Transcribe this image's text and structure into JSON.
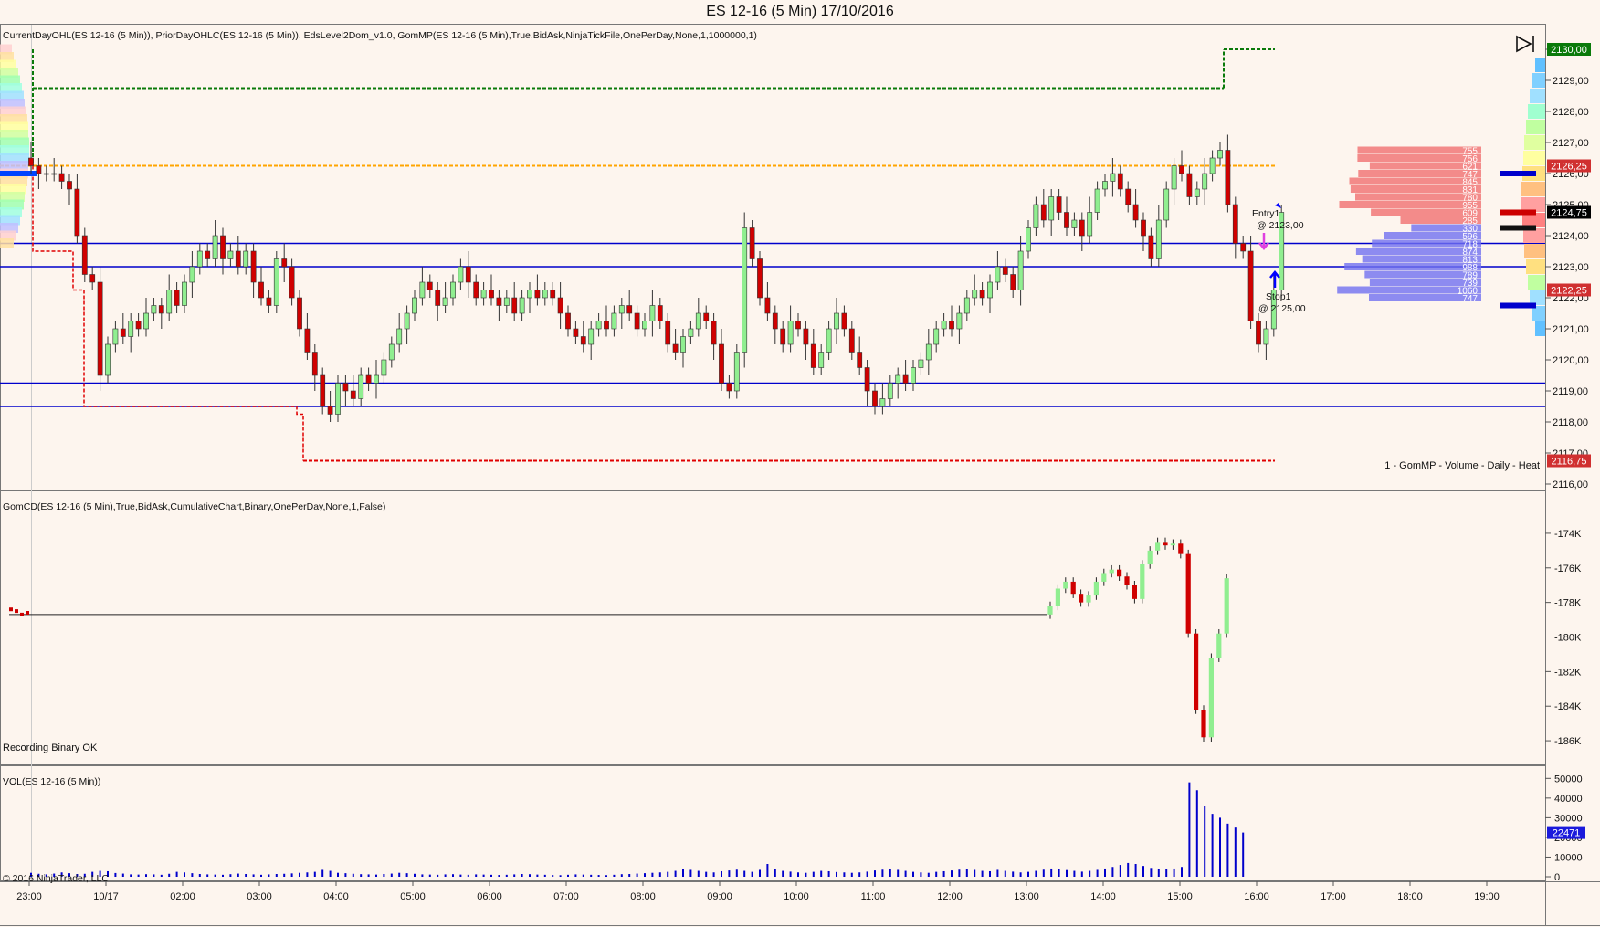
{
  "window": {
    "title": "ES 12-16 (5 Min)  17/10/2016"
  },
  "colors": {
    "background": "#fdf5ee",
    "up_candle": "#90ee90",
    "down_candle": "#d00000",
    "hline_blue": "#0000cc",
    "prior_high_green": "#0a7a0a",
    "orange_level": "#ffa500",
    "red_level": "#e00000",
    "volume_bar": "#0000cc"
  },
  "panels": {
    "price": {
      "indicator_label": "CurrentDayOHL(ES 12-16 (5 Min)), PriorDayOHLC(ES 12-16 (5 Min)), EdsLevel2Dom_v1.0, GomMP(ES 12-16 (5 Min),True,BidAsk,NinjaTickFile,OnePerDay,None,1,1000000,1)",
      "footer_label": "1 - GomMP  - Volume - Daily - Heat",
      "axis_ticks": [
        "2130,00",
        "2129,00",
        "2128,00",
        "2127,00",
        "2126,00",
        "2125,00",
        "2124,00",
        "2123,00",
        "2122,00",
        "2121,00",
        "2120,00",
        "2119,00",
        "2118,00",
        "2117,00",
        "2116,00"
      ],
      "badges": [
        {
          "text": "2130,00",
          "color": "#0a7a0a"
        },
        {
          "text": "2126,25",
          "color": "#d03030"
        },
        {
          "text": "2124,75",
          "color": "#000000"
        },
        {
          "text": "2122,25",
          "color": "#d03030"
        },
        {
          "text": "2116,75",
          "color": "#d03030"
        }
      ],
      "entry_label": "Entry1",
      "entry_price": "@ 2123,00",
      "stop_label": "Stop1",
      "stop_price": "@ 2125,00",
      "dom_values_ask": [
        "755",
        "756",
        "621",
        "747",
        "845",
        "831",
        "780",
        "955",
        "609",
        "285"
      ],
      "dom_values_bid": [
        "330",
        "596",
        "718",
        "874",
        "813",
        "988",
        "789",
        "739",
        "1060",
        "747"
      ],
      "replay_icon": "skip-to-end-icon"
    },
    "cumulative_delta": {
      "indicator_label": "GomCD(ES 12-16 (5 Min),True,BidAsk,CumulativeChart,Binary,OnePerDay,None,1,False)",
      "status_label": "Recording Binary OK",
      "axis_ticks": [
        "-174K",
        "-176K",
        "-178K",
        "-180K",
        "-182K",
        "-184K",
        "-186K"
      ]
    },
    "volume": {
      "indicator_label": "VOL(ES 12-16 (5 Min))",
      "copyright": "© 2016 NinjaTrader, LLC",
      "axis_ticks": [
        "50000",
        "40000",
        "30000",
        "20000",
        "10000",
        "0"
      ],
      "badge": "22471"
    }
  },
  "time_axis": [
    "23:00",
    "10/17",
    "02:00",
    "03:00",
    "04:00",
    "05:00",
    "06:00",
    "07:00",
    "08:00",
    "09:00",
    "10:00",
    "11:00",
    "12:00",
    "13:00",
    "14:00",
    "15:00",
    "16:00",
    "17:00",
    "18:00",
    "19:00"
  ],
  "chart_data": [
    {
      "type": "candlestick",
      "title": "ES 12-16 (5 Min)  17/10/2016",
      "ylim": [
        2116,
        2130.5
      ],
      "interval": "5 Min",
      "x_range": [
        "22:45",
        "19:45"
      ],
      "levels": [
        {
          "name": "prior high",
          "value": 2128.75
        },
        {
          "name": "orange level",
          "value": 2126.25
        },
        {
          "name": "blue line 1",
          "value": 2123.75
        },
        {
          "name": "blue line 2",
          "value": 2123.0
        },
        {
          "name": "prior close",
          "value": 2122.25
        },
        {
          "name": "blue line 3",
          "value": 2119.25
        },
        {
          "name": "blue line 4",
          "value": 2118.5
        },
        {
          "name": "prior low",
          "value": 2116.75
        },
        {
          "name": "green dashed high",
          "value": 2130.0
        }
      ],
      "closes": [
        2126.25,
        2126.0,
        2126.0,
        2126.0,
        2125.75,
        2125.5,
        2124.0,
        2122.75,
        2122.5,
        2119.5,
        2120.5,
        2121.0,
        2120.75,
        2121.25,
        2121.0,
        2121.5,
        2121.75,
        2121.5,
        2122.25,
        2121.75,
        2122.5,
        2123.0,
        2123.5,
        2123.25,
        2124.0,
        2123.25,
        2123.5,
        2123.0,
        2123.5,
        2122.5,
        2122.0,
        2121.75,
        2123.25,
        2123.0,
        2122.0,
        2121.0,
        2120.25,
        2119.5,
        2118.5,
        2118.25,
        2119.25,
        2119.0,
        2118.75,
        2119.5,
        2119.25,
        2119.5,
        2120.0,
        2120.5,
        2121.0,
        2121.5,
        2122.0,
        2122.5,
        2122.25,
        2121.75,
        2122.0,
        2122.5,
        2123.0,
        2122.5,
        2122.0,
        2122.25,
        2122.0,
        2121.75,
        2122.0,
        2121.5,
        2122.0,
        2122.25,
        2122.0,
        2122.25,
        2122.0,
        2121.5,
        2121.0,
        2120.75,
        2120.5,
        2121.0,
        2121.25,
        2121.0,
        2121.5,
        2121.75,
        2121.5,
        2121.0,
        2121.25,
        2121.75,
        2121.25,
        2120.5,
        2120.25,
        2120.75,
        2121.0,
        2121.5,
        2121.25,
        2120.5,
        2119.25,
        2119.0,
        2120.25,
        2124.25,
        2123.25,
        2122.0,
        2121.5,
        2121.0,
        2120.5,
        2121.25,
        2121.0,
        2120.5,
        2119.75,
        2120.25,
        2121.0,
        2121.5,
        2121.0,
        2120.25,
        2119.75,
        2119.0,
        2118.5,
        2118.75,
        2119.25,
        2119.5,
        2119.25,
        2119.75,
        2120.0,
        2120.5,
        2121.0,
        2121.25,
        2121.0,
        2121.5,
        2122.0,
        2122.25,
        2122.0,
        2122.5,
        2123.0,
        2122.75,
        2122.25,
        2123.5,
        2124.25,
        2125.0,
        2124.5,
        2125.25,
        2124.75,
        2124.25,
        2124.5,
        2124.0,
        2124.75,
        2125.5,
        2125.75,
        2126.0,
        2125.5,
        2125.0,
        2124.5,
        2124.0,
        2123.25,
        2124.5,
        2125.5,
        2126.25,
        2126.0,
        2125.25,
        2125.5,
        2126.0,
        2126.5,
        2126.75,
        2125.0,
        2123.75,
        2123.5,
        2121.25,
        2120.5,
        2121.0,
        2122.25,
        2124.75
      ]
    },
    {
      "type": "candlestick",
      "title": "GomCD(ES 12-16 (5 Min),True,BidAsk,CumulativeChart,Binary,OnePerDay,None,1,False)",
      "ylim": [
        -187000,
        -173000
      ],
      "flat_value": -178700,
      "closes": [
        -178200,
        -177200,
        -176800,
        -177500,
        -178000,
        -177600,
        -176800,
        -176300,
        -176100,
        -176500,
        -177000,
        -177800,
        -175800,
        -175000,
        -174500,
        -174700,
        -174600,
        -175200,
        -179800,
        -184200,
        -185800,
        -181200,
        -179800,
        -176600
      ]
    },
    {
      "type": "bar",
      "title": "VOL(ES 12-16 (5 Min))",
      "ylim": [
        0,
        52000
      ],
      "values": [
        2000,
        1500,
        1200,
        1600,
        2200,
        1800,
        1400,
        1500,
        2500,
        3000,
        2800,
        1900,
        1600,
        1200,
        1100,
        1300,
        1200,
        1000,
        1500,
        2500,
        2200,
        1800,
        1400,
        1200,
        1100,
        1000,
        1300,
        1600,
        1400,
        1200,
        1000,
        1200,
        1400,
        1500,
        1700,
        2000,
        2200,
        2500,
        3500,
        3000,
        2000,
        1800,
        1500,
        1300,
        1200,
        1100,
        1400,
        1600,
        2000,
        1800,
        1500,
        1200,
        1100,
        1000,
        1200,
        1300,
        1100,
        1000,
        1200,
        1100,
        1000,
        900,
        1000,
        1200,
        1400,
        1300,
        1100,
        1000,
        900,
        800,
        1000,
        1200,
        1100,
        1000,
        900,
        800,
        1000,
        1300,
        1400,
        1600,
        1800,
        2000,
        2200,
        2500,
        3000,
        4000,
        3500,
        3000,
        2500,
        2200,
        2800,
        3200,
        3600,
        3000,
        2500,
        3500,
        6500,
        4000,
        3000,
        2600,
        2200,
        2000,
        2500,
        3000,
        2800,
        2400,
        2200,
        2000,
        2200,
        2600,
        3200,
        3600,
        4000,
        3500,
        3000,
        2500,
        2200,
        2000,
        2500,
        2800,
        3200,
        3600,
        4000,
        3500,
        3000,
        2800,
        3500,
        3000,
        2600,
        2200,
        2500,
        3000,
        3600,
        4200,
        3800,
        3400,
        3000,
        2600,
        3000,
        3500,
        4200,
        5000,
        6000,
        7000,
        6500,
        5500,
        4500,
        4000,
        3800,
        4200,
        5000,
        48000,
        44000,
        36000,
        32000,
        30000,
        27000,
        25000,
        22471
      ]
    }
  ]
}
